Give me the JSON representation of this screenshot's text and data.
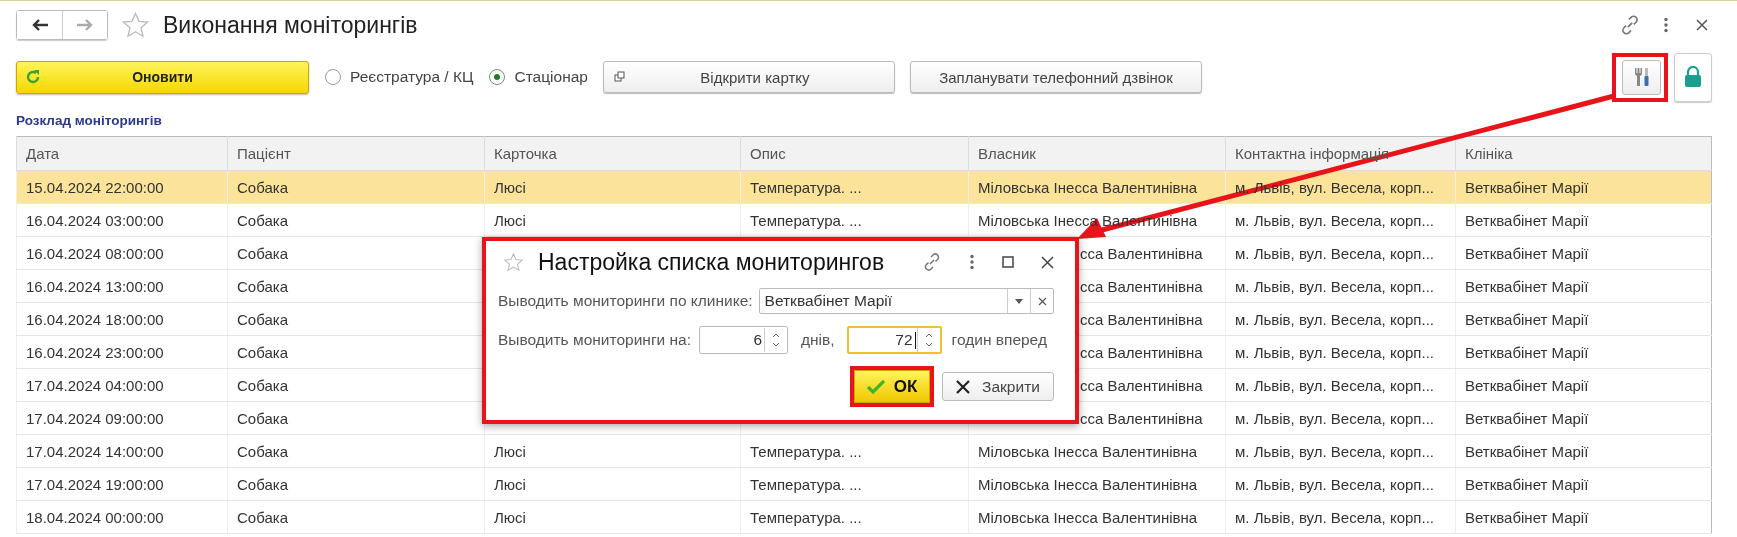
{
  "window": {
    "title": "Виконання моніторингів"
  },
  "toolbar": {
    "refresh_button": "Оновити",
    "modes": [
      {
        "label": "Реєстратура / КЦ",
        "selected": false
      },
      {
        "label": "Стаціонар",
        "selected": true
      }
    ],
    "buttons": [
      "Відкрити картку",
      "Запланувати телефонний дзвінок"
    ]
  },
  "section_title": "Розклад моніторингів",
  "table": {
    "columns": [
      "Дата",
      "Пацієнт",
      "Карточка",
      "Опис",
      "Власник",
      "Контактна інформація",
      "Клініка"
    ],
    "rows": [
      {
        "selected": true,
        "date": "15.04.2024 22:00:00",
        "patient": "Собака",
        "card": "Люсі",
        "description": "Температура. ...",
        "owner": "Міловська Інесса Валентинівна",
        "contact": "м. Львів, вул. Весела, корп...",
        "clinic": "Ветквабінет Марії"
      },
      {
        "selected": false,
        "date": "16.04.2024 03:00:00",
        "patient": "Собака",
        "card": "Люсі",
        "description": "Температура. ...",
        "owner": "Міловська Інесса Валентинівна",
        "contact": "м. Львів, вул. Весела, корп...",
        "clinic": "Ветквабінет Марії"
      },
      {
        "selected": false,
        "date": "16.04.2024 08:00:00",
        "patient": "Собака",
        "owner": "сса Валентинівна",
        "contact": "м. Львів, вул. Весела, корп...",
        "clinic": "Ветквабінет Марії"
      },
      {
        "selected": false,
        "date": "16.04.2024 13:00:00",
        "patient": "Собака",
        "owner": "сса Валентинівна",
        "contact": "м. Львів, вул. Весела, корп...",
        "clinic": "Ветквабінет Марії"
      },
      {
        "selected": false,
        "date": "16.04.2024 18:00:00",
        "patient": "Собака",
        "owner": "сса Валентинівна",
        "contact": "м. Львів, вул. Весела, корп...",
        "clinic": "Ветквабінет Марії"
      },
      {
        "selected": false,
        "date": "16.04.2024 23:00:00",
        "patient": "Собака",
        "owner": "сса Валентинівна",
        "contact": "м. Львів, вул. Весела, корп...",
        "clinic": "Ветквабінет Марії"
      },
      {
        "selected": false,
        "date": "17.04.2024 04:00:00",
        "patient": "Собака",
        "owner": "сса Валентинівна",
        "contact": "м. Львів, вул. Весела, корп...",
        "clinic": "Ветквабінет Марії"
      },
      {
        "selected": false,
        "date": "17.04.2024 09:00:00",
        "patient": "Собака",
        "owner": "сса Валентинівна",
        "contact": "м. Львів, вул. Весела, корп...",
        "clinic": "Ветквабінет Марії"
      },
      {
        "selected": false,
        "date": "17.04.2024 14:00:00",
        "patient": "Собака",
        "card": "Люсі",
        "description": "Температура. ...",
        "owner": "Міловська Інесса Валентинівна",
        "contact": "м. Львів, вул. Весела, корп...",
        "clinic": "Ветквабінет Марії"
      },
      {
        "selected": false,
        "date": "17.04.2024 19:00:00",
        "patient": "Собака",
        "card": "Люсі",
        "description": "Температура. ...",
        "owner": "Міловська Інесса Валентинівна",
        "contact": "м. Львів, вул. Весела, корп...",
        "clinic": "Ветквабінет Марії"
      },
      {
        "selected": false,
        "date": "18.04.2024 00:00:00",
        "patient": "Собака",
        "card": "Люсі",
        "description": "Температура. ...",
        "owner": "Міловська Інесса Валентинівна",
        "contact": "м. Львів, вул. Весела, корп...",
        "clinic": "Ветквабінет Марії"
      }
    ]
  },
  "dialog": {
    "title": "Настройка списка мониторингов",
    "clinic_label": "Выводить мониторинги по клинике:",
    "clinic_value": "Ветквабінет Марії",
    "period_label": "Выводить мониторинги на:",
    "days": {
      "value": "6",
      "focused": false
    },
    "days_unit": "днів,",
    "hours": {
      "value": "72",
      "focused": true
    },
    "hours_unit": "годин вперед",
    "ok_button": "ОК",
    "close_button": "Закрити"
  }
}
